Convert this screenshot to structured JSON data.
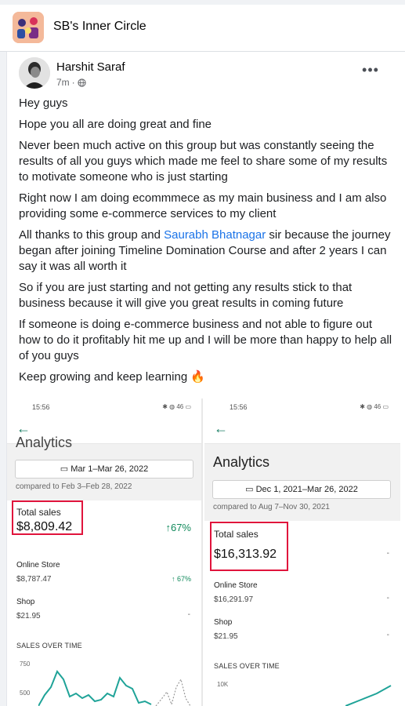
{
  "group": {
    "name": "SB's Inner Circle"
  },
  "post": {
    "author": "Harshit Saraf",
    "time": "7m",
    "privacy_icon": "globe-icon",
    "more_label": "•••",
    "paragraphs": [
      "Hey guys",
      "Hope you all are doing great and fine",
      "Never been much active on this group but was constantly seeing the results of all you guys which made me feel to share some of my results to motivate someone who is just starting",
      "Right now I am doing ecommmece as my main business and I am also providing some e-commerce services to my client"
    ],
    "thanks_before": "All thanks to this group and ",
    "thanks_link": "Saurabh Bhatnagar",
    "thanks_after": " sir because the journey began after joining Timeline Domination Course and after 2 years I can say it was all worth it",
    "paragraphs_after": [
      "So if you are just starting and not getting any results stick to that business because it will give you great results in coming future",
      "If someone is doing e-commerce business and not able to figure out how to do it profitably hit me up and I will be more than happy to help all of you guys"
    ],
    "closing": "Keep growing and keep learning",
    "closing_emoji": "🔥"
  },
  "screenshot_left": {
    "time": "15:56",
    "status_icons": "✱ ◍ 46 ▭",
    "title_partial": "Analytics",
    "date_range": "Mar 1–Mar 26, 2022",
    "compared": "compared to Feb 3–Feb 28, 2022",
    "total_sales_label": "Total sales",
    "total_sales_value": "$8,809.42",
    "total_change": "67%",
    "online_store_label": "Online Store",
    "online_store_value": "$8,787.47",
    "online_store_change": "67%",
    "shop_label": "Shop",
    "shop_value": "$21.95",
    "shop_change": "-",
    "section": "SALES OVER TIME",
    "axis": [
      "750",
      "500"
    ]
  },
  "screenshot_right": {
    "time": "15:56",
    "status_icons": "✱ ◍ 46 ▭",
    "title": "Analytics",
    "date_range": "Dec 1, 2021–Mar 26, 2022",
    "compared": "compared to Aug 7–Nov 30, 2021",
    "total_sales_label": "Total sales",
    "total_sales_value": "$16,313.92",
    "total_change": "-",
    "online_store_label": "Online Store",
    "online_store_value": "$16,291.97",
    "online_store_change": "-",
    "shop_label": "Shop",
    "shop_value": "$21.95",
    "shop_change": "-",
    "section": "SALES OVER TIME",
    "axis": [
      "10K"
    ]
  },
  "colors": {
    "link": "#1a73e8",
    "highlight": "#e0143c",
    "shopify_green": "#128a5c"
  }
}
